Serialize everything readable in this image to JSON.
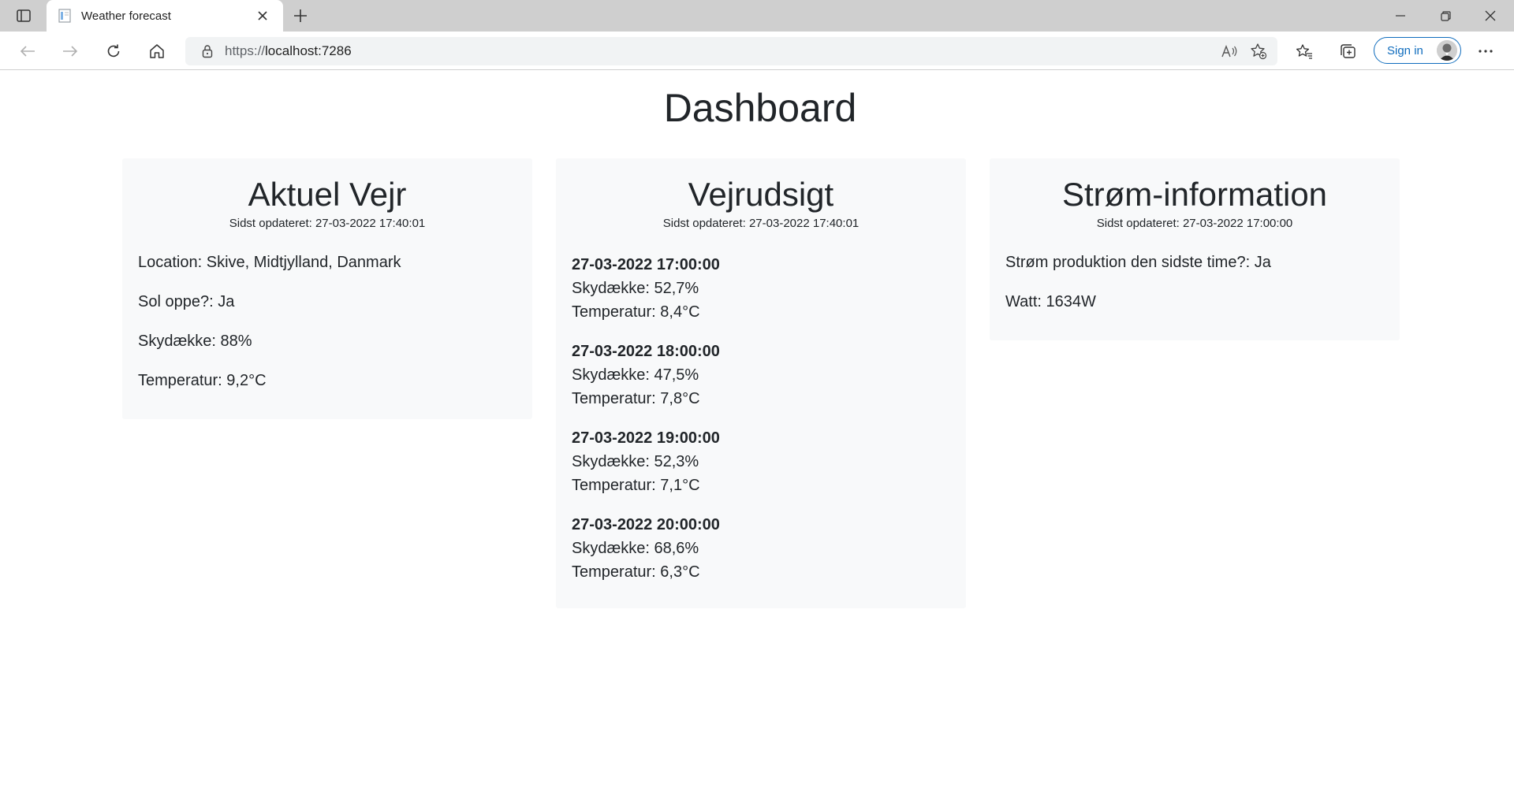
{
  "browser": {
    "tab_title": "Weather forecast",
    "url_prefix": "https://",
    "url_host": "localhost:7286",
    "sign_in_label": "Sign in"
  },
  "page": {
    "title": "Dashboard"
  },
  "current_weather": {
    "heading": "Aktuel Vejr",
    "updated": "Sidst opdateret: 27-03-2022 17:40:01",
    "items": [
      "Location: Skive, Midtjylland, Danmark",
      "Sol oppe?: Ja",
      "Skydække: 88%",
      "Temperatur: 9,2°C"
    ]
  },
  "forecast": {
    "heading": "Vejrudsigt",
    "updated": "Sidst opdateret: 27-03-2022 17:40:01",
    "entries": [
      {
        "time": "27-03-2022 17:00:00",
        "clouds": "Skydække: 52,7%",
        "temp": "Temperatur: 8,4°C"
      },
      {
        "time": "27-03-2022 18:00:00",
        "clouds": "Skydække: 47,5%",
        "temp": "Temperatur: 7,8°C"
      },
      {
        "time": "27-03-2022 19:00:00",
        "clouds": "Skydække: 52,3%",
        "temp": "Temperatur: 7,1°C"
      },
      {
        "time": "27-03-2022 20:00:00",
        "clouds": "Skydække: 68,6%",
        "temp": "Temperatur: 6,3°C"
      }
    ]
  },
  "power": {
    "heading": "Strøm-information",
    "updated": "Sidst opdateret: 27-03-2022 17:00:00",
    "items": [
      "Strøm produktion den sidste time?: Ja",
      "Watt: 1634W"
    ]
  },
  "colors": {
    "card_bg": "#f8f9fa",
    "text": "#212529",
    "accent": "#0f6cbd"
  }
}
